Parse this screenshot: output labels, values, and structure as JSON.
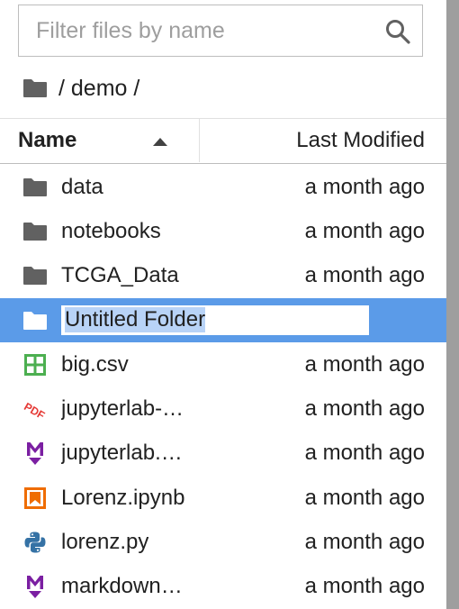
{
  "filter": {
    "placeholder": "Filter files by name",
    "value": ""
  },
  "breadcrumb": {
    "path": "/ demo /"
  },
  "header": {
    "name": "Name",
    "modified": "Last Modified",
    "sort": "ascending"
  },
  "files": [
    {
      "name": "data",
      "modified": "a month ago",
      "icon": "folder-icon"
    },
    {
      "name": "notebooks",
      "modified": "a month ago",
      "icon": "folder-icon"
    },
    {
      "name": "TCGA_Data",
      "modified": "a month ago",
      "icon": "folder-icon"
    },
    {
      "name": "Untitled Folder",
      "modified": "",
      "icon": "folder-icon",
      "renaming": true
    },
    {
      "name": "big.csv",
      "modified": "a month ago",
      "icon": "spreadsheet-icon"
    },
    {
      "name": "jupyterlab-…",
      "modified": "a month ago",
      "icon": "pdf-icon"
    },
    {
      "name": "jupyterlab.…",
      "modified": "a month ago",
      "icon": "markdown-icon"
    },
    {
      "name": "Lorenz.ipynb",
      "modified": "a month ago",
      "icon": "notebook-icon"
    },
    {
      "name": "lorenz.py",
      "modified": "a month ago",
      "icon": "python-icon"
    },
    {
      "name": "markdown…",
      "modified": "a month ago",
      "icon": "markdown-icon"
    }
  ],
  "colors": {
    "selected_row": "#5b9be8",
    "folder": "#616161",
    "csv": "#4caf50",
    "pdf": "#e53935",
    "markdown": "#7b1fa2",
    "notebook": "#ef6c00",
    "python_blue": "#3572a5",
    "python_yellow": "#f7c948"
  }
}
